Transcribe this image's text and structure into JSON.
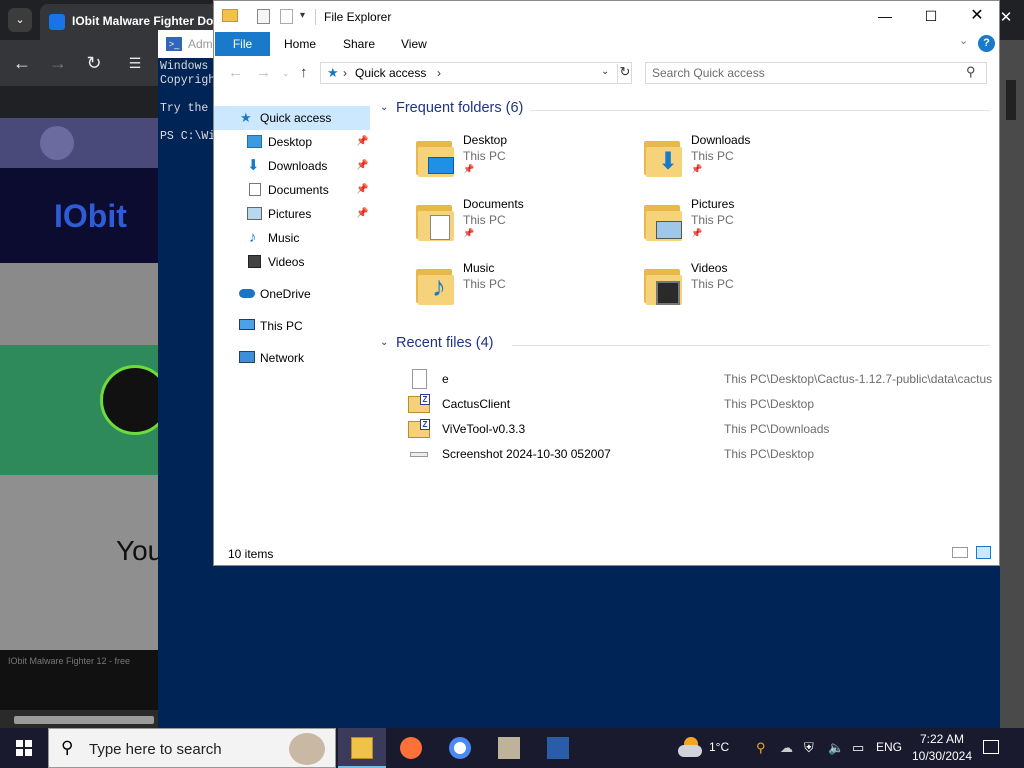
{
  "browser": {
    "tab_title": "IObit Malware Fighter Dov",
    "logo_text": "IObit",
    "hero_partial": "You",
    "footer_text": "IObit Malware Fighter 12 - free"
  },
  "powershell": {
    "title": "Adm",
    "lines": [
      "Windows",
      "Copyrigh",
      "",
      "Try the",
      "",
      "PS C:\\Wi"
    ]
  },
  "explorer": {
    "title": "File Explorer",
    "ribbon_tabs": [
      "File",
      "Home",
      "Share",
      "View"
    ],
    "address": "Quick access",
    "search_placeholder": "Search Quick access",
    "nav": [
      {
        "label": "Quick access",
        "icon": "star-icon",
        "pinned": false,
        "selected": true
      },
      {
        "label": "Desktop",
        "icon": "desktop-icon",
        "pinned": true
      },
      {
        "label": "Downloads",
        "icon": "download-icon",
        "pinned": true
      },
      {
        "label": "Documents",
        "icon": "documents-icon",
        "pinned": true
      },
      {
        "label": "Pictures",
        "icon": "pictures-icon",
        "pinned": true
      },
      {
        "label": "Music",
        "icon": "music-icon",
        "pinned": false
      },
      {
        "label": "Videos",
        "icon": "videos-icon",
        "pinned": false
      },
      {
        "label": "OneDrive",
        "icon": "cloud-icon",
        "pinned": false
      },
      {
        "label": "This PC",
        "icon": "computer-icon",
        "pinned": false
      },
      {
        "label": "Network",
        "icon": "network-icon",
        "pinned": false
      }
    ],
    "frequent_header": "Frequent folders (6)",
    "frequent": [
      {
        "name": "Desktop",
        "location": "This PC",
        "pinned": true,
        "icon": "desktop-icon"
      },
      {
        "name": "Downloads",
        "location": "This PC",
        "pinned": true,
        "icon": "download-icon"
      },
      {
        "name": "Documents",
        "location": "This PC",
        "pinned": true,
        "icon": "documents-icon"
      },
      {
        "name": "Pictures",
        "location": "This PC",
        "pinned": true,
        "icon": "pictures-icon"
      },
      {
        "name": "Music",
        "location": "This PC",
        "pinned": false,
        "icon": "music-icon"
      },
      {
        "name": "Videos",
        "location": "This PC",
        "pinned": false,
        "icon": "videos-icon"
      }
    ],
    "recent_header": "Recent files (4)",
    "recent": [
      {
        "name": "e",
        "path": "This PC\\Desktop\\Cactus-1.12.7-public\\data\\cactus",
        "icon": "text-file-icon"
      },
      {
        "name": "CactusClient",
        "path": "This PC\\Desktop",
        "icon": "archive-file-icon"
      },
      {
        "name": "ViVeTool-v0.3.3",
        "path": "This PC\\Downloads",
        "icon": "archive-file-icon"
      },
      {
        "name": "Screenshot 2024-10-30 052007",
        "path": "This PC\\Desktop",
        "icon": "image-file-icon"
      }
    ],
    "status": "10 items"
  },
  "taskbar": {
    "search_text": "Type here to search",
    "temperature": "1°C",
    "language": "ENG",
    "time": "7:22 AM",
    "date": "10/30/2024"
  }
}
